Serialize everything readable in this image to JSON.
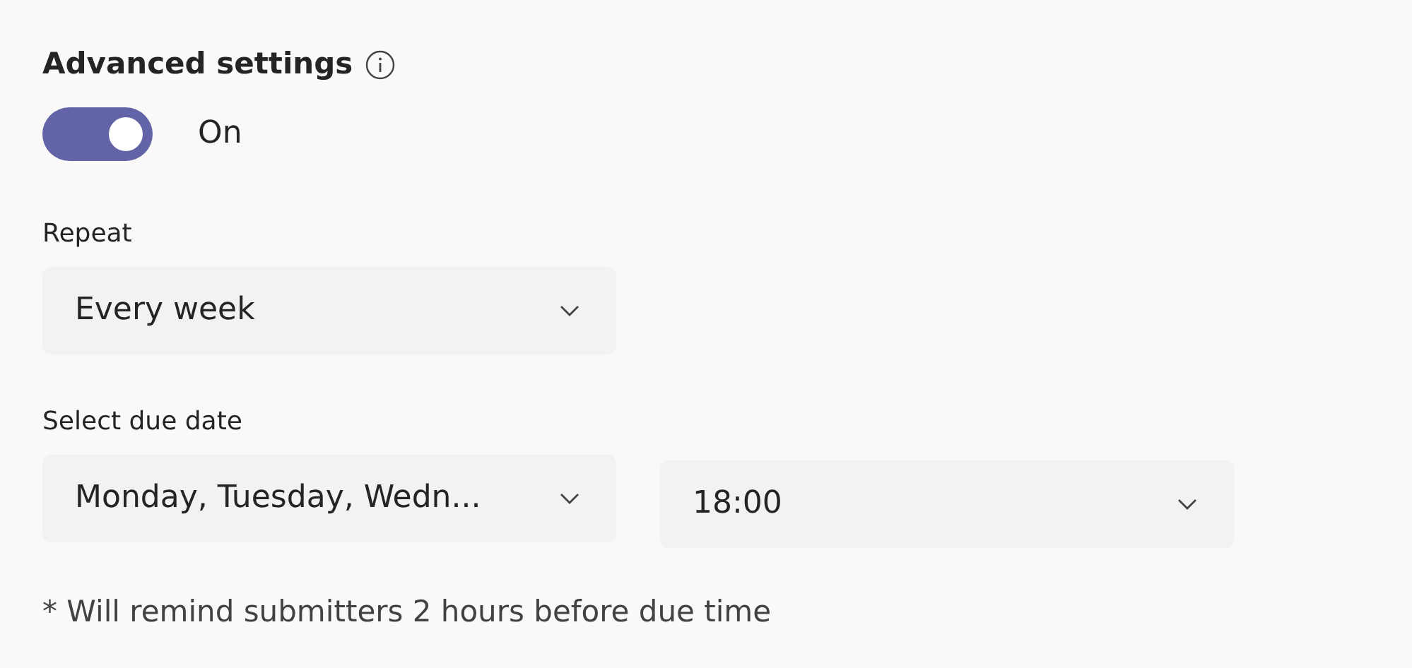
{
  "section": {
    "title": "Advanced settings"
  },
  "toggle": {
    "on": true,
    "label": "On"
  },
  "repeat": {
    "label": "Repeat",
    "value": "Every week"
  },
  "due_date": {
    "label": "Select due date",
    "dropdowns": [
      {
        "value": "Monday, Tuesday, Wedn..."
      },
      {
        "value": "18:00"
      }
    ]
  },
  "note": "* Will remind submitters 2 hours before due time"
}
